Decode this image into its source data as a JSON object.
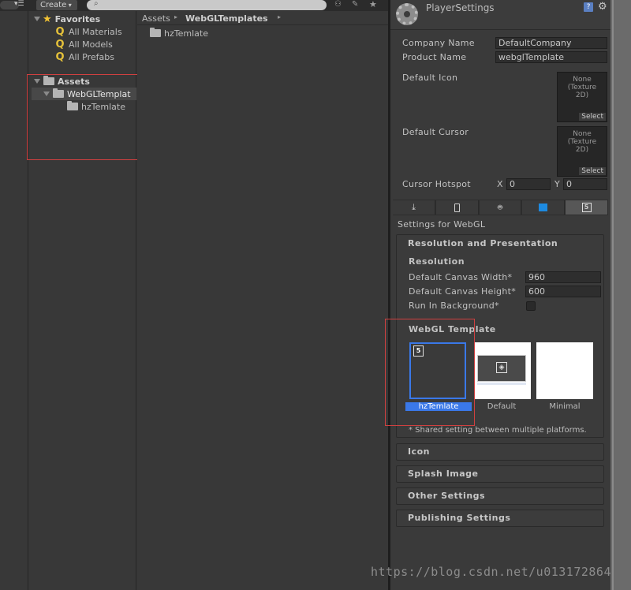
{
  "toolbar": {
    "create_label": "Create",
    "search_placeholder": ""
  },
  "favorites": {
    "title": "Favorites",
    "items": [
      "All Materials",
      "All Models",
      "All Prefabs"
    ]
  },
  "assets_tree": {
    "root": "Assets",
    "child": "WebGLTemplat",
    "grandchild": "hzTemlate"
  },
  "breadcrumb": {
    "parts": [
      "Assets",
      "WebGLTemplates"
    ]
  },
  "content_list": {
    "items": [
      "hzTemlate"
    ]
  },
  "inspector": {
    "title": "PlayerSettings",
    "company_name_label": "Company Name",
    "company_name_value": "DefaultCompany",
    "product_name_label": "Product Name",
    "product_name_value": "webglTemplate",
    "default_icon_label": "Default Icon",
    "default_cursor_label": "Default Cursor",
    "texture_slot_text": [
      "None",
      "(Texture",
      "2D)"
    ],
    "select_label": "Select",
    "cursor_hotspot_label": "Cursor Hotspot",
    "hotspot_x_label": "X",
    "hotspot_x_value": "0",
    "hotspot_y_label": "Y",
    "hotspot_y_value": "0",
    "settings_for": "Settings for WebGL",
    "res_presentation": "Resolution and Presentation",
    "resolution": "Resolution",
    "canvas_width_label": "Default Canvas Width*",
    "canvas_width_value": "960",
    "canvas_height_label": "Default Canvas Height*",
    "canvas_height_value": "600",
    "run_in_bg_label": "Run In Background*",
    "run_in_bg_checked": false,
    "webgl_template": "WebGL Template",
    "templates": [
      "hzTemlate",
      "Default",
      "Minimal"
    ],
    "selected_template": "hzTemlate",
    "shared_note": "* Shared setting between multiple platforms.",
    "sections": [
      "Icon",
      "Splash Image",
      "Other Settings",
      "Publishing Settings"
    ]
  },
  "platform_tabs": [
    "download-icon",
    "mobile-icon",
    "android-icon",
    "windows-icon",
    "html5-icon"
  ],
  "watermark": "https://blog.csdn.net/u013172864",
  "colors": {
    "highlight": "#d04040",
    "selected_caption": "#3a78e8",
    "star": "#f4c434"
  }
}
